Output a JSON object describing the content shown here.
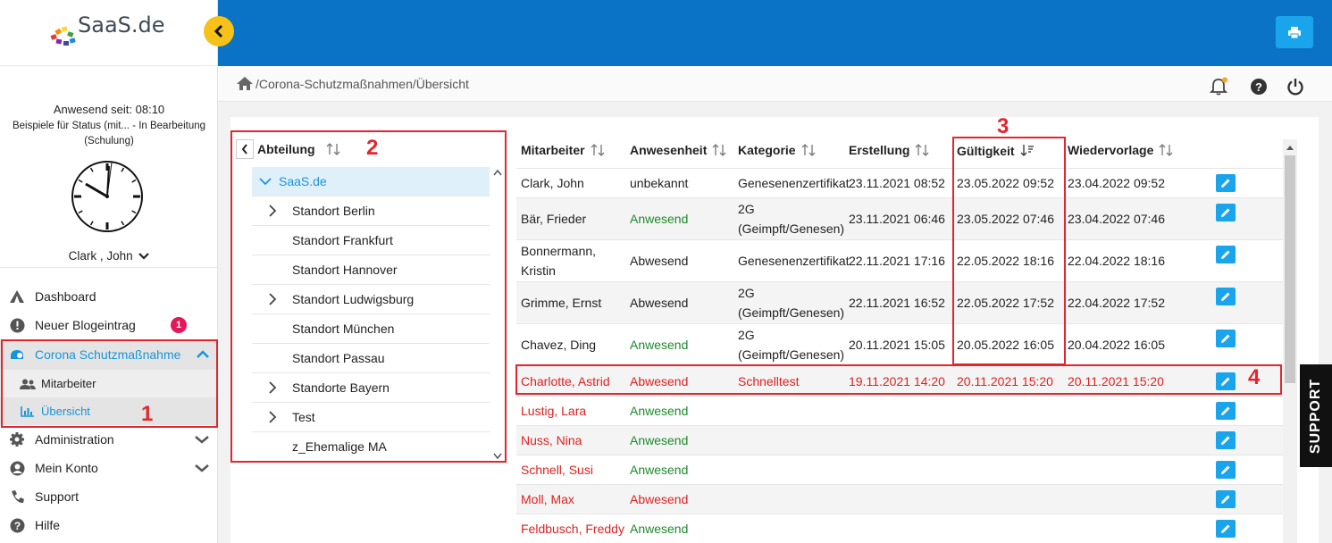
{
  "app": {
    "logo_text": "SaaS.de"
  },
  "user_panel": {
    "present_since": "Anwesend seit: 08:10",
    "status_text": "Beispiele für Status (mit... - In Bearbeitung (Schulung)",
    "user_name": "Clark , John"
  },
  "nav": {
    "dashboard": "Dashboard",
    "blog": "Neuer Blogeintrag",
    "blog_badge": "1",
    "corona": "Corona Schutzmaßnahme",
    "employees": "Mitarbeiter",
    "overview": "Übersicht",
    "administration": "Administration",
    "account": "Mein Konto",
    "support": "Support",
    "help": "Hilfe"
  },
  "breadcrumb": "/Corona-Schutzmaßnahmen/Übersicht",
  "tree": {
    "header": "Abteilung",
    "items": [
      {
        "label": "SaaS.de",
        "level": 0,
        "expandable": true,
        "expanded": true
      },
      {
        "label": "Standort Berlin",
        "level": 1,
        "expandable": true
      },
      {
        "label": "Standort Frankfurt",
        "level": 1,
        "expandable": false
      },
      {
        "label": "Standort Hannover",
        "level": 1,
        "expandable": false
      },
      {
        "label": "Standort Ludwigsburg",
        "level": 1,
        "expandable": true
      },
      {
        "label": "Standort München",
        "level": 1,
        "expandable": false
      },
      {
        "label": "Standort Passau",
        "level": 1,
        "expandable": false
      },
      {
        "label": "Standorte Bayern",
        "level": 1,
        "expandable": true
      },
      {
        "label": "Test",
        "level": 1,
        "expandable": true
      },
      {
        "label": "z_Ehemalige MA",
        "level": 1,
        "expandable": false
      }
    ]
  },
  "table": {
    "columns": [
      "Mitarbeiter",
      "Anwesenheit",
      "Kategorie",
      "Erstellung",
      "Gültigkeit",
      "Wiedervorlage"
    ],
    "rows": [
      {
        "name": "Clark, John",
        "presence": "unbekannt",
        "category": "Genesenenzertifikat",
        "created": "23.11.2021 08:52",
        "valid": "23.05.2022 09:52",
        "followup": "23.04.2022 09:52",
        "state": "none",
        "highlight": false
      },
      {
        "name": "Bär, Frieder",
        "presence": "Anwesend",
        "category": "2G (Geimpft/Genesen)",
        "created": "23.11.2021 06:46",
        "valid": "23.05.2022 07:46",
        "followup": "23.04.2022 07:46",
        "state": "present",
        "highlight": false
      },
      {
        "name": "Bonnermann, Kristin",
        "presence": "Abwesend",
        "category": "Genesenenzertifikat",
        "created": "22.11.2021 17:16",
        "valid": "22.05.2022 18:16",
        "followup": "22.04.2022 18:16",
        "state": "absent",
        "highlight": false
      },
      {
        "name": "Grimme, Ernst",
        "presence": "Abwesend",
        "category": "2G (Geimpft/Genesen)",
        "created": "22.11.2021 16:52",
        "valid": "22.05.2022 17:52",
        "followup": "22.04.2022 17:52",
        "state": "absent",
        "highlight": false
      },
      {
        "name": "Chavez, Ding",
        "presence": "Anwesend",
        "category": "2G (Geimpft/Genesen)",
        "created": "20.11.2021 15:05",
        "valid": "20.05.2022 16:05",
        "followup": "20.04.2022 16:05",
        "state": "present",
        "highlight": false
      },
      {
        "name": "Charlotte, Astrid",
        "presence": "Abwesend",
        "category": "Schnelltest",
        "created": "19.11.2021 14:20",
        "valid": "20.11.2021 15:20",
        "followup": "20.11.2021 15:20",
        "state": "absent",
        "highlight": true
      },
      {
        "name": "Lustig, Lara",
        "presence": "Anwesend",
        "category": "",
        "created": "",
        "valid": "",
        "followup": "",
        "state": "present",
        "highlight": true
      },
      {
        "name": "Nuss, Nina",
        "presence": "Anwesend",
        "category": "",
        "created": "",
        "valid": "",
        "followup": "",
        "state": "present",
        "highlight": true
      },
      {
        "name": "Schnell, Susi",
        "presence": "Anwesend",
        "category": "",
        "created": "",
        "valid": "",
        "followup": "",
        "state": "present",
        "highlight": true
      },
      {
        "name": "Moll, Max",
        "presence": "Abwesend",
        "category": "",
        "created": "",
        "valid": "",
        "followup": "",
        "state": "absent",
        "highlight": true
      },
      {
        "name": "Feldbusch, Freddy",
        "presence": "Anwesend",
        "category": "",
        "created": "",
        "valid": "",
        "followup": "",
        "state": "present",
        "highlight": true
      }
    ]
  },
  "annotations": [
    "1",
    "1",
    "2",
    "3",
    "4"
  ],
  "support_tab": "SUPPORT",
  "colors": {
    "topbar": "#0b73c5",
    "accent": "#1aa4ec",
    "annotation": "#e3262e",
    "present": "#1b8a2a",
    "alert": "#e02020"
  }
}
